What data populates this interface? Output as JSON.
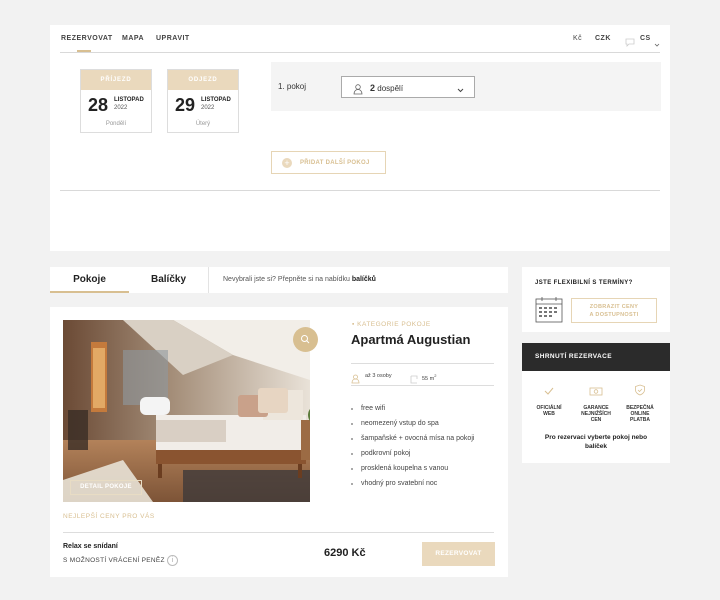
{
  "nav": {
    "tabs": [
      "REZERVOVAT",
      "MAPA",
      "UPRAVIT"
    ],
    "currency_symbol": "Kč",
    "currency": "CZK",
    "language": "CS"
  },
  "dates": {
    "checkin": {
      "label": "PŘÍJEZD",
      "day": "28",
      "month": "LISTOPAD",
      "year": "2022",
      "weekday": "Pondělí"
    },
    "checkout": {
      "label": "ODJEZD",
      "day": "29",
      "month": "LISTOPAD",
      "year": "2022",
      "weekday": "Úterý"
    }
  },
  "rooms": {
    "room_label": "1. pokoj",
    "guests_count": "2",
    "guests_unit": "dospělí",
    "add_room": "PŘIDAT DALŠÍ POKOJ"
  },
  "tabs": {
    "rooms": "Pokoje",
    "packages": "Balíčky",
    "note_prefix": "Nevybrali jste si? Přepněte si na nabídku",
    "note_link": "balíčků"
  },
  "flexible": {
    "title": "JSTE FLEXIBILNÍ S TERMÍNY?",
    "button_line1": "ZOBRAZIT CENY",
    "button_line2": "A DOSTUPNOSTI"
  },
  "summary": {
    "title": "SHRNUTÍ REZERVACE",
    "features": [
      {
        "line1": "OFICIÁLNÍ",
        "line2": "WEB",
        "line3": "",
        "icon": "check-icon"
      },
      {
        "line1": "GARANCE",
        "line2": "NEJNIŽŠÍCH",
        "line3": "CEN",
        "icon": "money-icon"
      },
      {
        "line1": "BEZPEČNÁ",
        "line2": "ONLINE",
        "line3": "PLATBA",
        "icon": "shield-icon"
      }
    ],
    "message": "Pro rezervaci vyberte pokoj nebo balíček"
  },
  "room": {
    "category": "KATEGORIE POKOJE",
    "name": "Apartmá Augustian",
    "occupancy": "až 3 osoby",
    "area_value": "55 m",
    "area_sup": "2",
    "detail_button": "DETAIL POKOJE",
    "amenities": [
      "free wifi",
      "neomezený vstup do spa",
      "šampaňské + ovocná mísa na pokoji",
      "podkrovní pokoj",
      "prosklená koupelna s vanou",
      "vhodný pro svatební noc"
    ],
    "best_prices": "NEJLEPŠÍ CENY PRO VÁS",
    "rate_name": "Relax se snídaní",
    "rate_note": "S MOŽNOSTÍ VRÁCENÍ PENĚZ",
    "price": "6290 Kč",
    "book_button": "REZERVOVAT"
  },
  "colors": {
    "accent": "#d8bf91",
    "accent_light": "#ead9bd",
    "dark": "#2b2b2b",
    "background": "#f2f2f2"
  }
}
